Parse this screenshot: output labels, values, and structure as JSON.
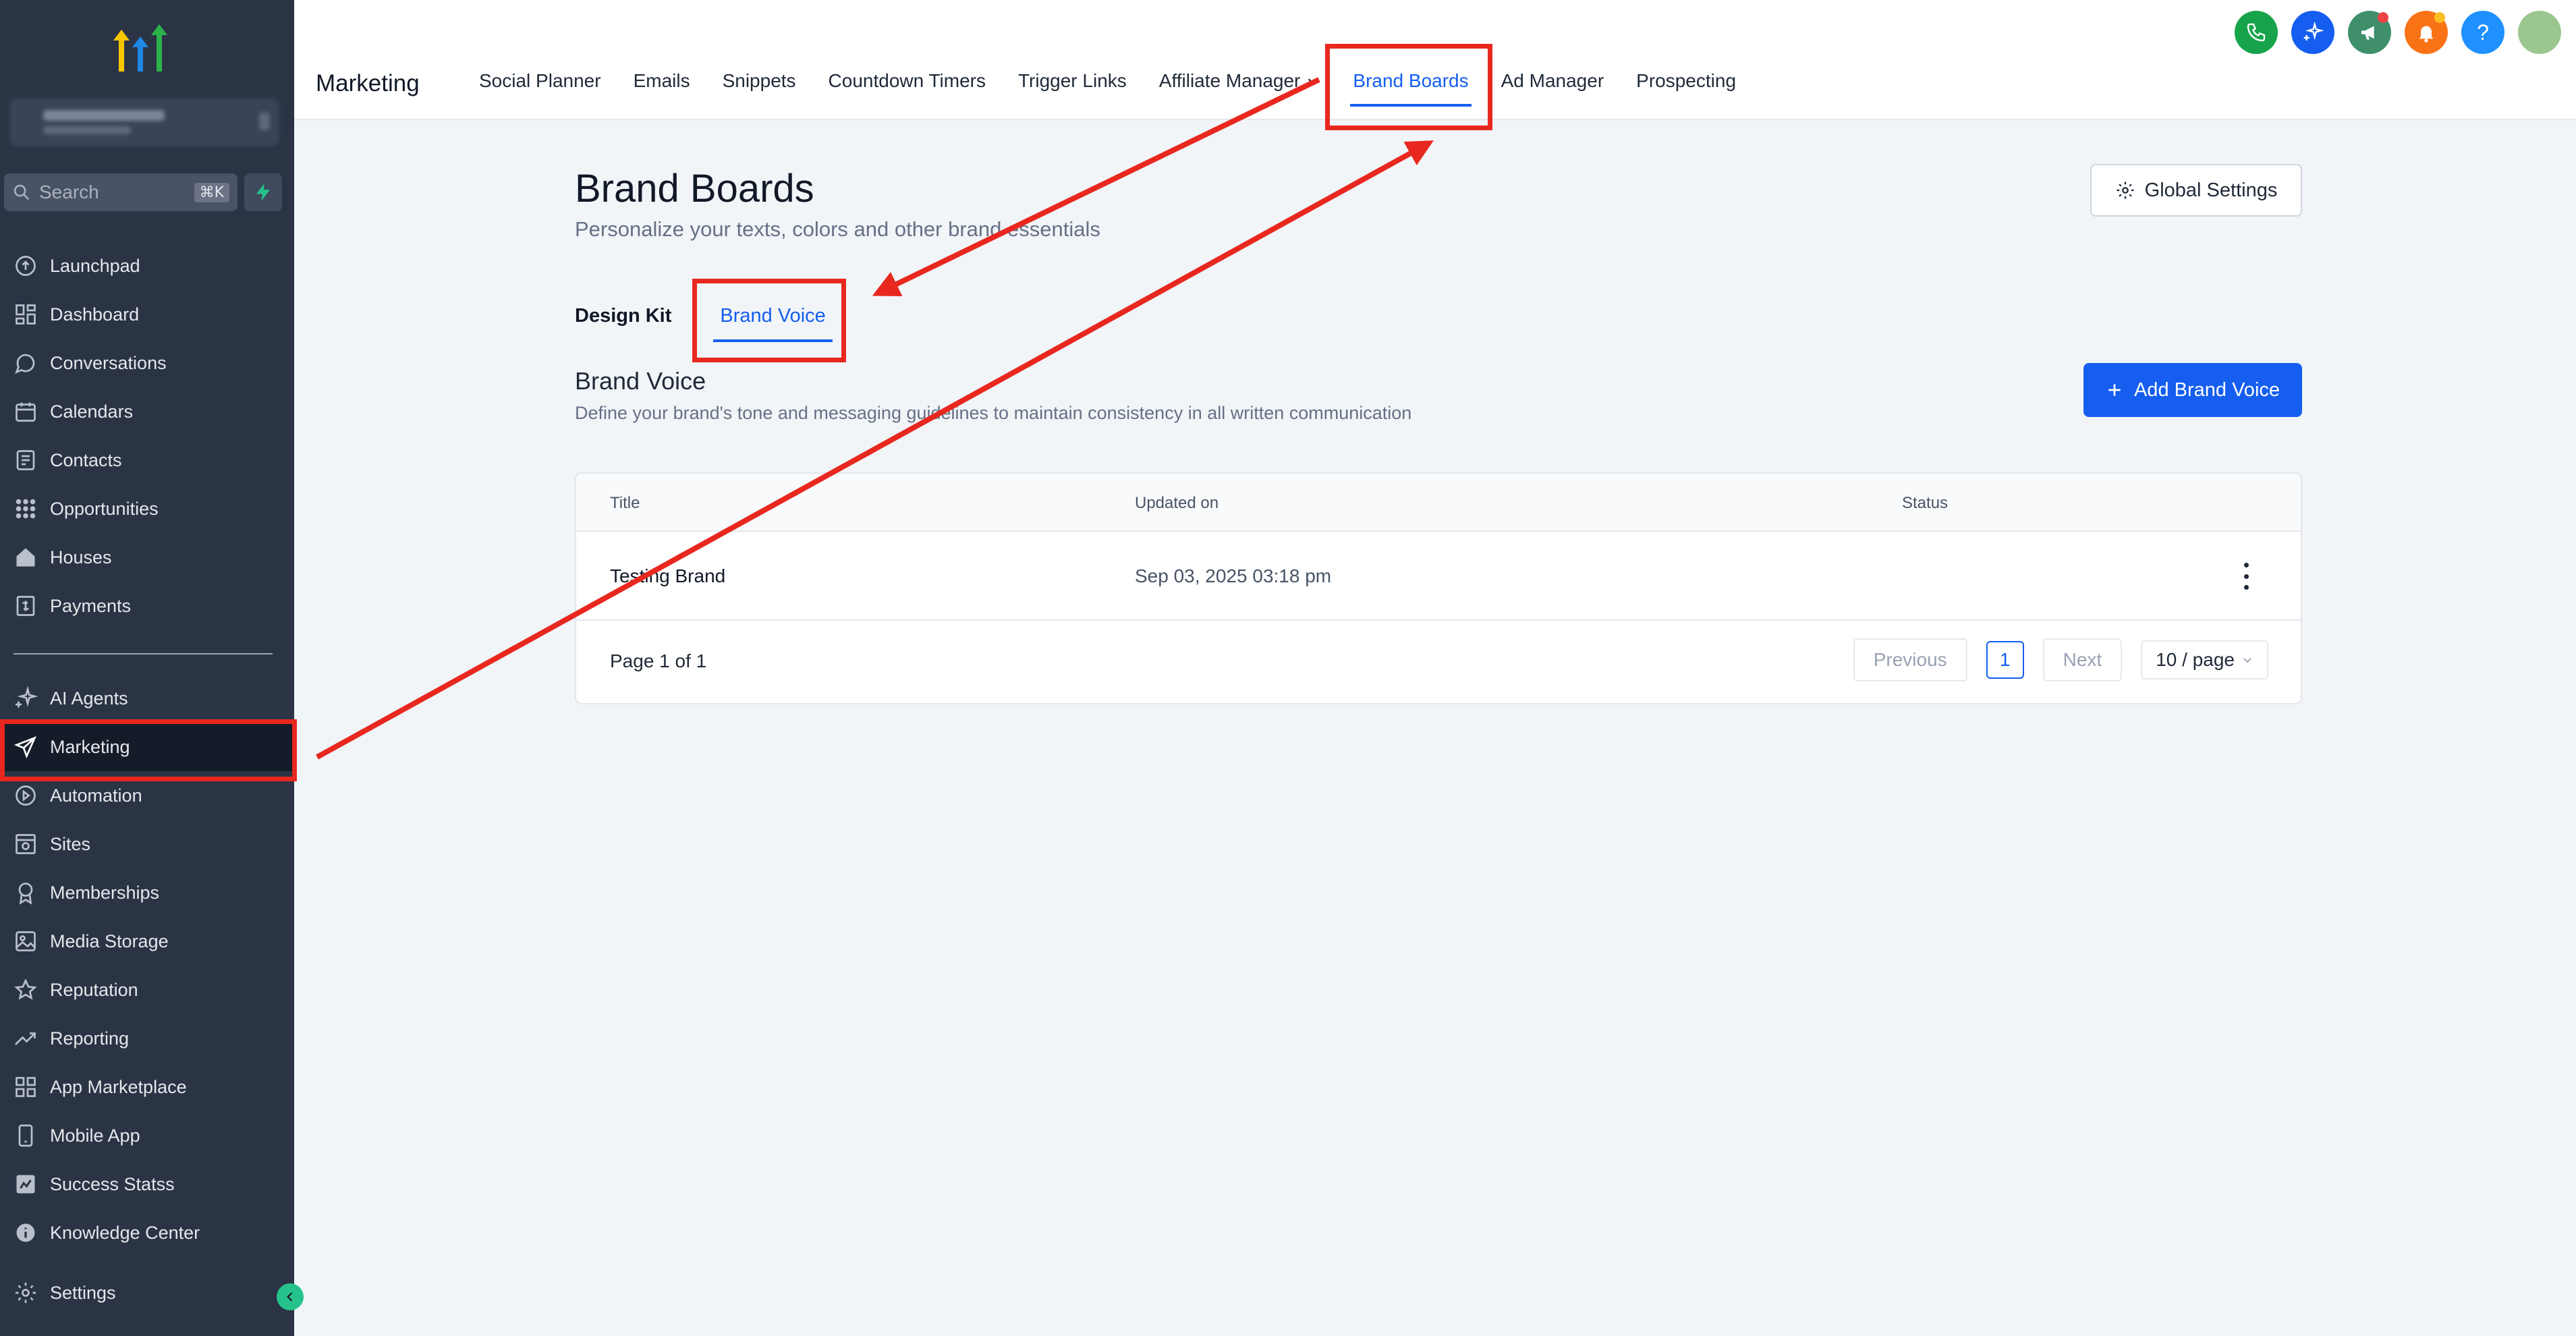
{
  "sidebar": {
    "search_placeholder": "Search",
    "search_shortcut": "⌘K",
    "items": [
      {
        "label": "Launchpad",
        "icon": "rocket-icon"
      },
      {
        "label": "Dashboard",
        "icon": "grid-icon"
      },
      {
        "label": "Conversations",
        "icon": "chat-icon"
      },
      {
        "label": "Calendars",
        "icon": "calendar-icon"
      },
      {
        "label": "Contacts",
        "icon": "contacts-icon"
      },
      {
        "label": "Opportunities",
        "icon": "opportunities-icon"
      },
      {
        "label": "Houses",
        "icon": "house-icon"
      },
      {
        "label": "Payments",
        "icon": "payments-icon"
      },
      {
        "label": "AI Agents",
        "icon": "sparkle-icon"
      },
      {
        "label": "Marketing",
        "icon": "send-icon"
      },
      {
        "label": "Automation",
        "icon": "automation-icon"
      },
      {
        "label": "Sites",
        "icon": "sites-icon"
      },
      {
        "label": "Memberships",
        "icon": "award-icon"
      },
      {
        "label": "Media Storage",
        "icon": "image-icon"
      },
      {
        "label": "Reputation",
        "icon": "star-icon"
      },
      {
        "label": "Reporting",
        "icon": "trend-icon"
      },
      {
        "label": "App Marketplace",
        "icon": "apps-icon"
      },
      {
        "label": "Mobile App",
        "icon": "mobile-icon"
      },
      {
        "label": "Success Statss",
        "icon": "stats-icon"
      },
      {
        "label": "Knowledge Center",
        "icon": "info-icon"
      },
      {
        "label": "Settings",
        "icon": "gear-icon"
      }
    ]
  },
  "topbar": {
    "title": "Marketing",
    "nav": [
      {
        "label": "Social Planner"
      },
      {
        "label": "Emails"
      },
      {
        "label": "Snippets"
      },
      {
        "label": "Countdown Timers"
      },
      {
        "label": "Trigger Links"
      },
      {
        "label": "Affiliate Manager"
      },
      {
        "label": "Brand Boards"
      },
      {
        "label": "Ad Manager"
      },
      {
        "label": "Prospecting"
      }
    ]
  },
  "page": {
    "title": "Brand Boards",
    "subtitle": "Personalize your texts, colors and other brand essentials",
    "global_settings": "Global Settings",
    "tabs": [
      {
        "label": "Design Kit"
      },
      {
        "label": "Brand Voice"
      }
    ],
    "section_title": "Brand Voice",
    "section_subtitle": "Define your brand's tone and messaging guidelines to maintain consistency in all written communication",
    "add_button": "Add Brand Voice"
  },
  "table": {
    "headers": [
      "Title",
      "Updated on",
      "Status"
    ],
    "rows": [
      {
        "title": "Testing Brand",
        "updated": "Sep 03, 2025 03:18 pm",
        "status": ""
      }
    ],
    "page_info": "Page 1 of 1",
    "previous": "Previous",
    "current_page": "1",
    "next": "Next",
    "page_size": "10 / page"
  },
  "colors": {
    "sidebar_bg": "#2b3445",
    "accent": "#155eef",
    "highlight": "#e8281f"
  }
}
